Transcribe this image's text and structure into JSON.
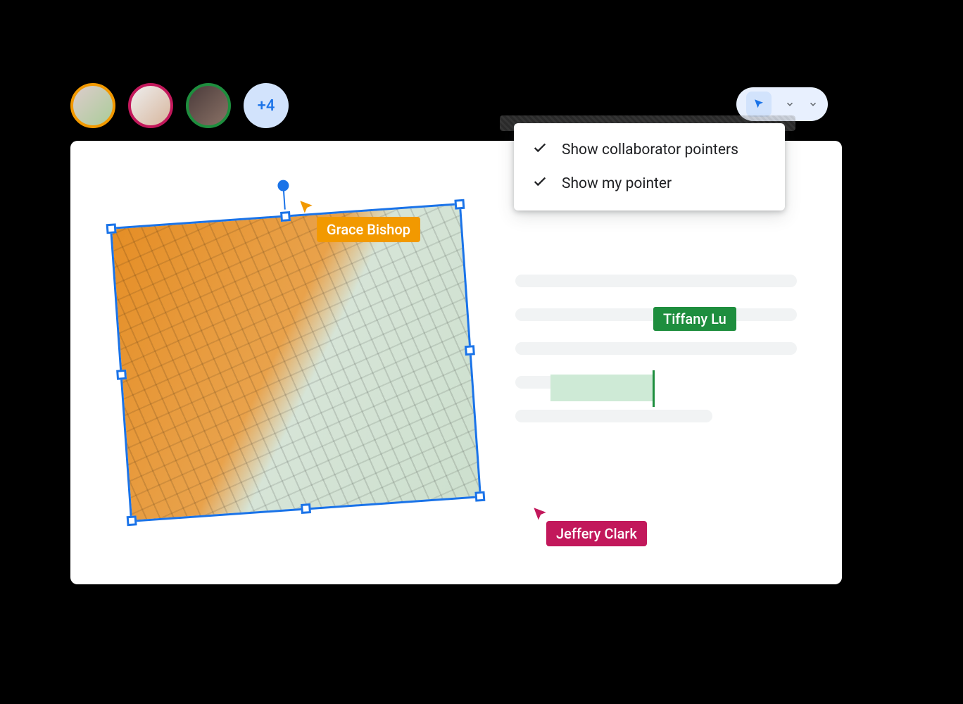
{
  "avatars": {
    "more_count": "+4"
  },
  "toolbar": {
    "menu": {
      "show_collaborators": "Show collaborator pointers",
      "show_my_pointer": "Show my pointer"
    }
  },
  "collaborators": {
    "grace": {
      "name": "Grace Bishop",
      "color": "#F29900"
    },
    "tiffany": {
      "name": "Tiffany Lu",
      "color": "#1E8E3E"
    },
    "jeffery": {
      "name": "Jeffery Clark",
      "color": "#C2185B"
    }
  }
}
